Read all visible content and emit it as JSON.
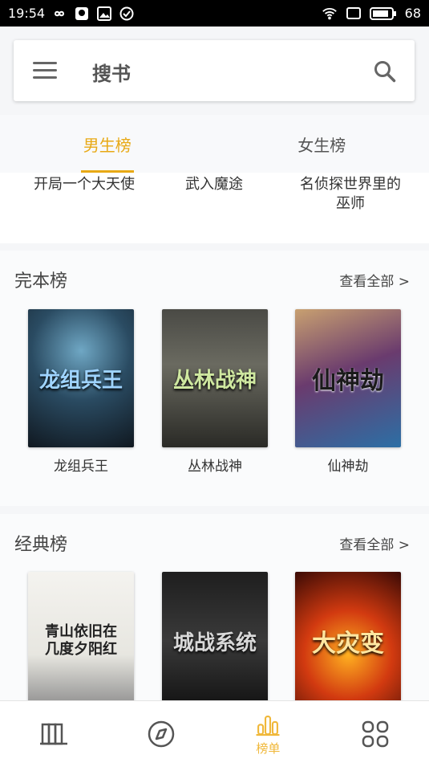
{
  "status": {
    "time": "19:54",
    "battery": "68"
  },
  "search": {
    "title": "搜书"
  },
  "tabs": [
    {
      "label": "男生榜",
      "active": true
    },
    {
      "label": "女生榜",
      "active": false
    }
  ],
  "top_list": [
    {
      "title": "开局一个大天使"
    },
    {
      "title": "武入魔途"
    },
    {
      "title": "名侦探世界里的\n巫师"
    }
  ],
  "sections": [
    {
      "title": "完本榜",
      "more": "查看全部 >",
      "books": [
        {
          "name": "龙组兵王",
          "cover_text": "龙组兵王"
        },
        {
          "name": "丛林战神",
          "cover_text": "丛林战神"
        },
        {
          "name": "仙神劫",
          "cover_text": "仙神劫"
        }
      ]
    },
    {
      "title": "经典榜",
      "more": "查看全部 >",
      "books": [
        {
          "name": "",
          "cover_text": "青山依旧在 几度夕阳红"
        },
        {
          "name": "",
          "cover_text": "城战系统"
        },
        {
          "name": "",
          "cover_text": "大灾变"
        }
      ]
    }
  ],
  "bottom_nav": [
    {
      "icon": "bookshelf-icon",
      "label": ""
    },
    {
      "icon": "compass-icon",
      "label": ""
    },
    {
      "icon": "ranking-icon",
      "label": "榜单",
      "active": true
    },
    {
      "icon": "grid-icon",
      "label": ""
    }
  ],
  "colors": {
    "accent": "#e8a915",
    "nav_active": "#f0b83a"
  }
}
